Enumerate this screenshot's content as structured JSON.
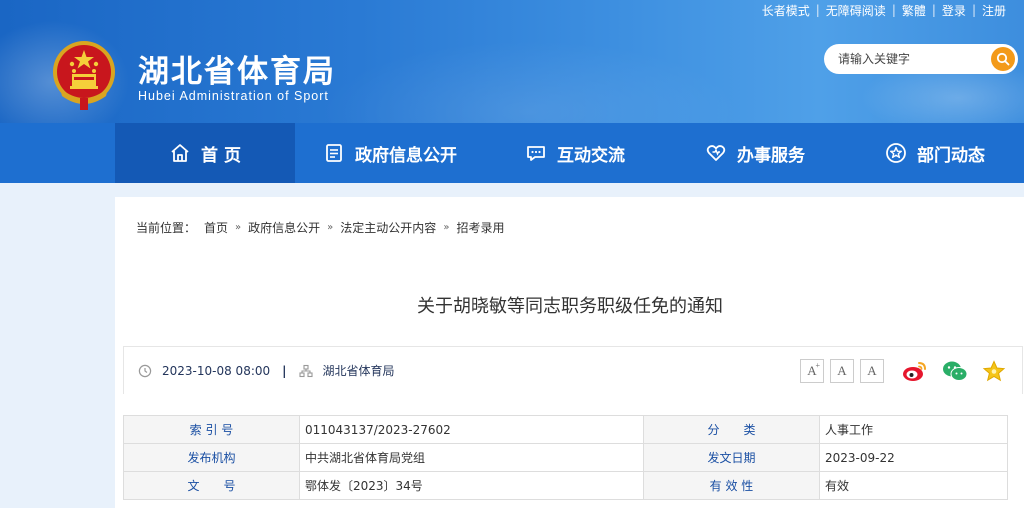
{
  "toplinks": [
    "长者模式",
    "无障碍阅读",
    "繁體",
    "登录",
    "注册"
  ],
  "header": {
    "title": "湖北省体育局",
    "subtitle": "Hubei Administration of Sport"
  },
  "search": {
    "placeholder": "请输入关键字"
  },
  "nav": [
    {
      "label": "首 页",
      "icon": "home-icon"
    },
    {
      "label": "政府信息公开",
      "icon": "document-icon"
    },
    {
      "label": "互动交流",
      "icon": "chat-icon"
    },
    {
      "label": "办事服务",
      "icon": "heart-icon"
    },
    {
      "label": "部门动态",
      "icon": "star-icon"
    }
  ],
  "breadcrumb": {
    "prefix": "当前位置：",
    "items": [
      "首页",
      "政府信息公开",
      "法定主动公开内容",
      "招考录用"
    ]
  },
  "article": {
    "title": "关于胡晓敏等同志职务职级任免的通知",
    "datetime": "2023-10-08 08:00",
    "source": "湖北省体育局"
  },
  "font_buttons": [
    "A",
    "A",
    "A"
  ],
  "info": {
    "rows": [
      {
        "l1": "索 引 号",
        "v1": "011043137/2023-27602",
        "l2": "分　　类",
        "v2": "人事工作"
      },
      {
        "l1": "发布机构",
        "v1": "中共湖北省体育局党组",
        "l2": "发文日期",
        "v2": "2023-09-22"
      },
      {
        "l1": "文　　号",
        "v1": "鄂体发〔2023〕34号",
        "l2": "有 效 性",
        "v2": "有效"
      }
    ]
  },
  "colors": {
    "nav_bg": "#1e6fd0",
    "nav_active": "#1459b5",
    "label_blue": "#1a4fa3",
    "search_button": "#f39a1a"
  }
}
